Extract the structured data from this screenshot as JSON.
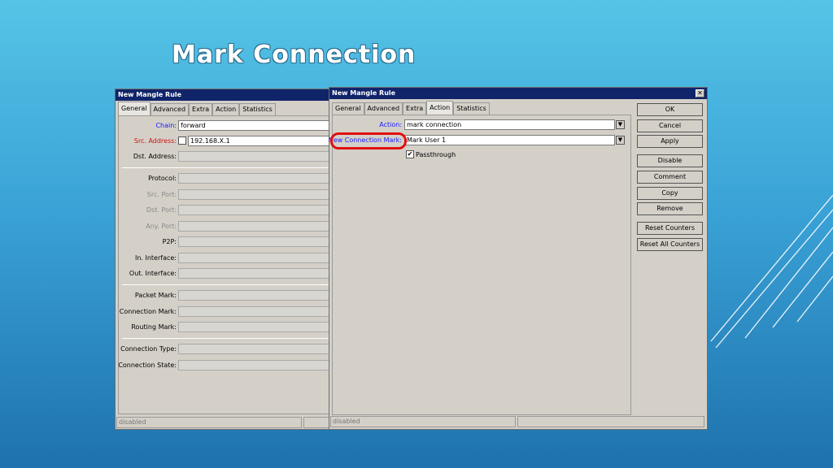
{
  "slide": {
    "title": "Mark Connection"
  },
  "left_window": {
    "title": "New Mangle Rule",
    "tabs": [
      "General",
      "Advanced",
      "Extra",
      "Action",
      "Statistics"
    ],
    "active_tab": "General",
    "chain": {
      "label": "Chain:",
      "value": "forward"
    },
    "src_address": {
      "label": "Src. Address:",
      "value": "192.168.X.1"
    },
    "dst_address": {
      "label": "Dst. Address:",
      "value": ""
    },
    "protocol": {
      "label": "Protocol:"
    },
    "src_port": {
      "label": "Src. Port:"
    },
    "dst_port": {
      "label": "Dst. Port:"
    },
    "any_port": {
      "label": "Any. Port:"
    },
    "p2p": {
      "label": "P2P:"
    },
    "in_interface": {
      "label": "In. Interface:"
    },
    "out_interface": {
      "label": "Out. Interface:"
    },
    "packet_mark": {
      "label": "Packet Mark:"
    },
    "connection_mark": {
      "label": "Connection Mark:"
    },
    "routing_mark": {
      "label": "Routing Mark:"
    },
    "connection_type": {
      "label": "Connection Type:"
    },
    "connection_state": {
      "label": "Connection State:"
    },
    "status": "disabled"
  },
  "right_window": {
    "title": "New Mangle Rule",
    "tabs": [
      "General",
      "Advanced",
      "Extra",
      "Action",
      "Statistics"
    ],
    "active_tab": "Action",
    "action": {
      "label": "Action:",
      "value": "mark connection"
    },
    "new_connection_mark": {
      "label": "New Connection Mark:",
      "value": "Mark User 1"
    },
    "passthrough": {
      "label": "Passthrough",
      "checked": true
    },
    "buttons": {
      "ok": "OK",
      "cancel": "Cancel",
      "apply": "Apply",
      "disable": "Disable",
      "comment": "Comment",
      "copy": "Copy",
      "remove": "Remove",
      "reset_counters": "Reset Counters",
      "reset_all_counters": "Reset All Counters"
    },
    "status": "disabled"
  },
  "colors": {
    "titlebar": "#10246a",
    "highlight": "#e01010",
    "window_bg": "#d4d0c8"
  }
}
